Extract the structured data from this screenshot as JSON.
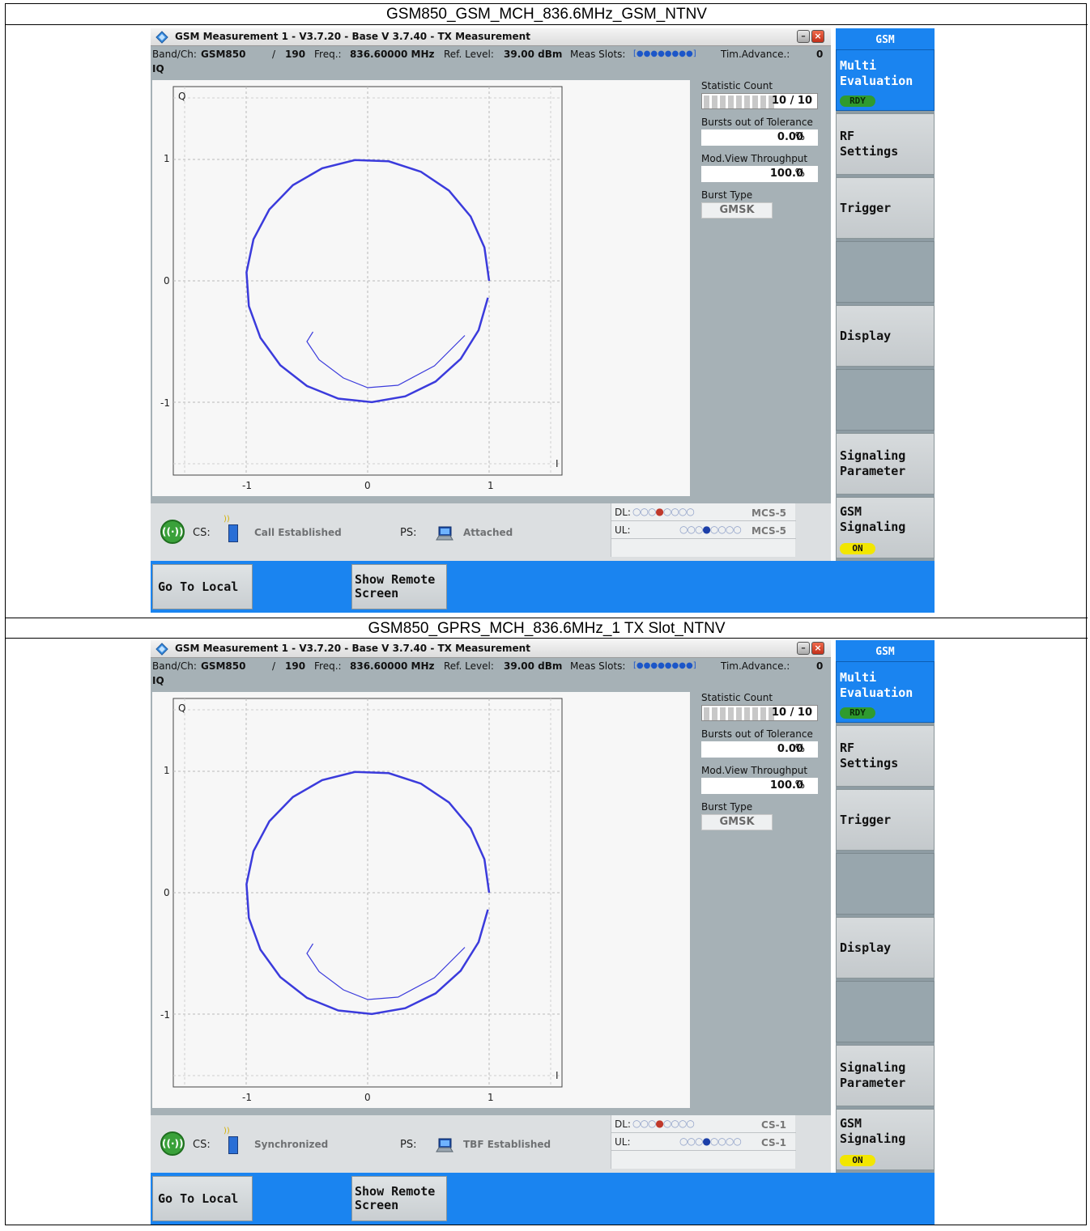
{
  "captions": [
    "GSM850_GSM_MCH_836.6MHz_GSM_NTNV",
    "GSM850_GPRS_MCH_836.6MHz_1 TX Slot_NTNV"
  ],
  "screens": [
    {
      "title": "GSM Measurement 1 - V3.7.20 - Base V 3.7.40 - TX Measurement",
      "info": {
        "band_label": "Band/Ch:",
        "band": "GSM850",
        "ch_sep": "/",
        "ch": "190",
        "freq_label": "Freq.:",
        "freq": "836.60000 MHz",
        "ref_label": "Ref. Level:",
        "ref": "39.00 dBm",
        "slots_label": "Meas Slots:",
        "slots": "[●●●●●●●●]",
        "ta_label": "Tim.Advance.:",
        "ta": "0"
      },
      "view_label": "IQ",
      "axes": {
        "y_label": "Q",
        "x_label": "I",
        "y_ticks": [
          "1",
          "0",
          "-1"
        ],
        "x_ticks": [
          "-1",
          "0",
          "1"
        ]
      },
      "stats": {
        "statistic_count_label": "Statistic Count",
        "statistic_count": "10 / 10",
        "bursts_label": "Bursts out of Tolerance",
        "bursts": "0.00",
        "bursts_unit": "%",
        "throughput_label": "Mod.View Throughput",
        "throughput": "100.0",
        "throughput_unit": "%",
        "burst_type_label": "Burst Type",
        "burst_type": "GMSK"
      },
      "status": {
        "cs_label": "CS:",
        "cs_state": "Call Established",
        "ps_label": "PS:",
        "ps_state": "Attached",
        "dl_label": "DL:",
        "dl_coding": "MCS-5",
        "ul_label": "UL:",
        "ul_coding": "MCS-5"
      },
      "sidebar": {
        "header": "GSM",
        "items": [
          "Multi\nEvaluation",
          "RF\nSettings",
          "Trigger",
          "",
          "Display",
          "",
          "Signaling\nParameter",
          "GSM\nSignaling"
        ],
        "rdy": "RDY",
        "on": "ON"
      },
      "bottom": {
        "go_local": "Go To Local",
        "remote": "Show Remote\nScreen"
      }
    },
    {
      "title": "GSM Measurement 1 - V3.7.20 - Base V 3.7.40 - TX Measurement",
      "info": {
        "band_label": "Band/Ch:",
        "band": "GSM850",
        "ch_sep": "/",
        "ch": "190",
        "freq_label": "Freq.:",
        "freq": "836.60000 MHz",
        "ref_label": "Ref. Level:",
        "ref": "39.00 dBm",
        "slots_label": "Meas Slots:",
        "slots": "[●●●●●●●●]",
        "ta_label": "Tim.Advance.:",
        "ta": "0"
      },
      "view_label": "IQ",
      "axes": {
        "y_label": "Q",
        "x_label": "I",
        "y_ticks": [
          "1",
          "0",
          "-1"
        ],
        "x_ticks": [
          "-1",
          "0",
          "1"
        ]
      },
      "stats": {
        "statistic_count_label": "Statistic Count",
        "statistic_count": "10 / 10",
        "bursts_label": "Bursts out of Tolerance",
        "bursts": "0.00",
        "bursts_unit": "%",
        "throughput_label": "Mod.View Throughput",
        "throughput": "100.0",
        "throughput_unit": "%",
        "burst_type_label": "Burst Type",
        "burst_type": "GMSK"
      },
      "status": {
        "cs_label": "CS:",
        "cs_state": "Synchronized",
        "ps_label": "PS:",
        "ps_state": "TBF Established",
        "dl_label": "DL:",
        "dl_coding": "CS-1",
        "ul_label": "UL:",
        "ul_coding": "CS-1"
      },
      "sidebar": {
        "header": "GSM",
        "items": [
          "Multi\nEvaluation",
          "RF\nSettings",
          "Trigger",
          "",
          "Display",
          "",
          "Signaling\nParameter",
          "GSM\nSignaling"
        ],
        "rdy": "RDY",
        "on": "ON"
      },
      "bottom": {
        "go_local": "Go To Local",
        "remote": "Show Remote\nScreen"
      }
    }
  ],
  "colors": {
    "accent": "#1a84f0",
    "trace": "#3b3bdc",
    "ready": "#2f9b2f",
    "on": "#f2e600"
  }
}
